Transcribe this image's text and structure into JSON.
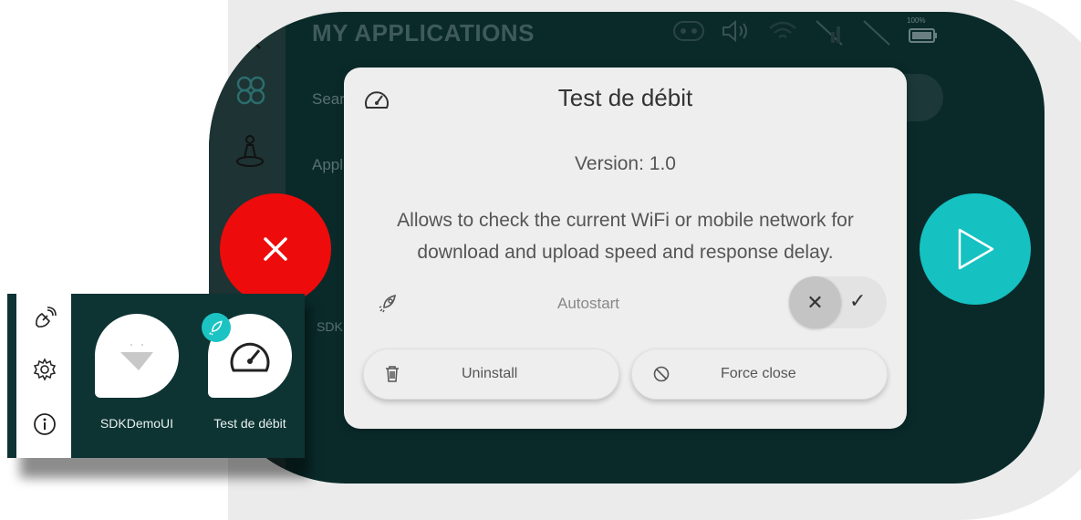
{
  "device": {
    "title": "MY APPLICATIONS",
    "search_partial": "Sear",
    "apps_partial": "Appl",
    "sdk_partial": "SDK",
    "battery_percent": "100%"
  },
  "modal": {
    "title": "Test de débit",
    "version": "Version: 1.0",
    "description": "Allows to check the current WiFi or mobile network for download and upload speed and response delay.",
    "autostart_label": "Autostart",
    "autostart_enabled": false,
    "uninstall_label": "Uninstall",
    "force_close_label": "Force close"
  },
  "inset": {
    "apps": [
      {
        "label": "SDKDemoUI"
      },
      {
        "label": "Test de débit"
      }
    ]
  },
  "colors": {
    "close": "#ee0b0b",
    "play": "#15c1c1",
    "device_bg": "#0a2a2a",
    "modal_bg": "#eeeeee"
  },
  "icons": {
    "close": "close-icon",
    "play": "play-icon",
    "gauge": "speedometer-icon",
    "rocket": "rocket-icon",
    "trash": "trash-icon",
    "ban": "ban-icon",
    "satellite": "satellite-icon",
    "gear": "gear-icon",
    "info": "info-icon"
  }
}
